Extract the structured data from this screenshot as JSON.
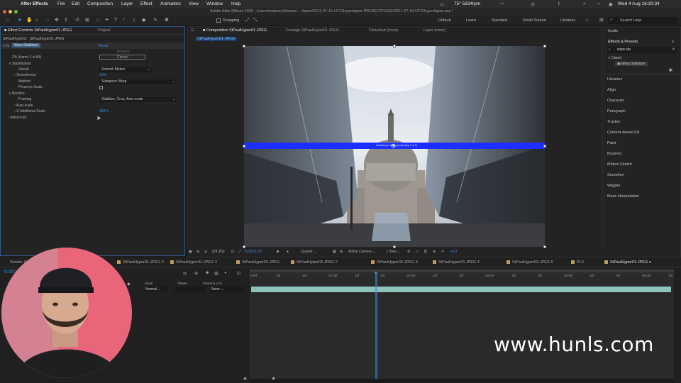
{
  "menubar": {
    "app": "After Effects",
    "items": [
      "File",
      "Edit",
      "Composition",
      "Layer",
      "Effect",
      "Animation",
      "View",
      "Window",
      "Help"
    ],
    "weather": "75° 5834rpm",
    "clock": "Wed 4 Aug  16:30:34"
  },
  "titlebar": {
    "text": "Adobe After Effects 2020 - /Users/matinez/Movies/... /lapse/2021-07-15-UTC/hyperlapse-PROJECTFILES/2021-07-15-UTC/hyperlapse.aep *"
  },
  "toolbar": {
    "snapping": "Snapping",
    "workspaces": [
      "Default",
      "Learn",
      "Standard",
      "Small Screen",
      "Libraries"
    ],
    "search_placeholder": "Search Help"
  },
  "effect_controls": {
    "tab_label": "Effect Controls StPaulHyper01-JPEG",
    "tab_project": "Project",
    "layer_path": "StPaulHyper01 - StPaulHyper01-JPEG",
    "effect_name": "Warp Stabilizer",
    "reset": "Reset",
    "analyze": "Analyze",
    "cancel": "Cancel",
    "status": "2% (frame 3 of 84)",
    "stabilization": "Stabilization",
    "result_label": "Result",
    "result_value": "Smooth Motion",
    "smoothness_label": "Smoothness",
    "smoothness_value": "10%",
    "method_label": "Method",
    "method_value": "Subspace Warp",
    "preserve_label": "Preserve Scale",
    "borders": "Borders",
    "framing_label": "Framing",
    "framing_value": "Stabilize, Crop, Auto-scale",
    "autoscale_label": "Auto-scale",
    "additional_label": "Additional Scale",
    "additional_value": "100%",
    "advanced": "Advanced"
  },
  "composition": {
    "tab_label": "Composition StPaulHyper01-JPEG",
    "footage_tab": "Footage StPaulHyper01-JPEG",
    "flowchart_tab": "Flowchart (none)",
    "layer_tab": "Layer (none)",
    "comp_chip": "StPaulHyper01-JPEG",
    "overlay_text": "Analyzing in background (step 1 of 2)",
    "zoom": "(28.3%)",
    "timecode": "0:00:01:00",
    "resolution": "Quarter",
    "camera": "Active Camera",
    "views": "1 View",
    "exposure": "+0.0"
  },
  "right_panel": {
    "audio": "Audio",
    "effects_presets": "Effects & Presets",
    "search_value": "warp sta",
    "category": "Distort",
    "result": "Warp Stabilizer",
    "items": [
      "Libraries",
      "Align",
      "Character",
      "Paragraph",
      "Tracker",
      "Content-Aware Fill",
      "Paint",
      "Brushes",
      "Motion Sketch",
      "Smoother",
      "Wiggler",
      "Mask Interpolation"
    ]
  },
  "timeline": {
    "render_queue": "Render Queue",
    "tabs": [
      "StPaulHyper01-JPEG 2",
      "StPaulHyper01-JPEG 3",
      "StPaulHyper02-JPEG",
      "StPaulHyper03-JPEG 2",
      "StPaulHyper03-JPEG 3",
      "StPaulHyper03-JPEG 4",
      "StPaulHyper03-JPEG 5",
      "PL3",
      "StPaulHyper01-JPEG"
    ],
    "timecode": "0:00:0",
    "col_mode": "Mode",
    "col_trkmat": "TrkMat",
    "col_parent": "Parent & Link",
    "mode_value": "Normal",
    "parent_value": "None",
    "ruler_labels": [
      "0:00f",
      "10f",
      "20f",
      "01:00f",
      "10f",
      "20f",
      "02:00f",
      "10f",
      "20f",
      "03:00f",
      "10f",
      "20f",
      "04:00f",
      "10f",
      "20f",
      "05:00f",
      "10f"
    ]
  },
  "watermark": "www.hunls.com",
  "colors": {
    "accent": "#2d8ceb",
    "layer_bar": "#8fc2bc",
    "analysis_bar": "#1d2fff",
    "webcam_bg": "#e8657a"
  }
}
